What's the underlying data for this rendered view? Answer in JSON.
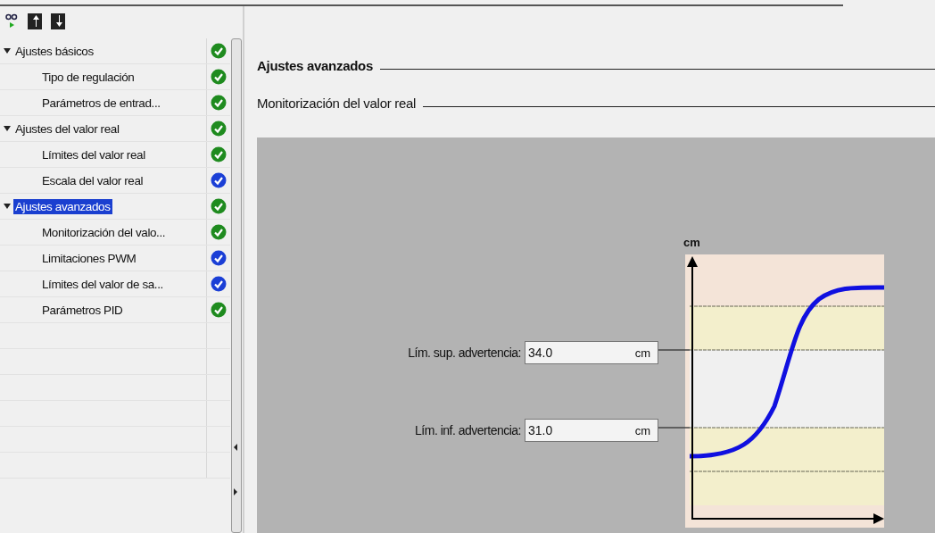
{
  "toolbar": {
    "buttons": [
      {
        "kind": "monitor"
      },
      {
        "kind": "upload"
      },
      {
        "kind": "download"
      }
    ]
  },
  "tree": [
    {
      "label": "Ajustes básicos",
      "expanded": true,
      "selected": false,
      "color": "#1f8b1f",
      "children": [
        {
          "label": "Tipo de regulación",
          "selected": false,
          "color": "#1f8b1f"
        },
        {
          "label": "Parámetros de entrad...",
          "selected": false,
          "color": "#1f8b1f"
        }
      ]
    },
    {
      "label": "Ajustes del valor real",
      "expanded": true,
      "selected": false,
      "color": "#1f8b1f",
      "children": [
        {
          "label": "Límites del valor real",
          "selected": false,
          "color": "#1f8b1f"
        },
        {
          "label": "Escala del valor real",
          "selected": false,
          "color": "#1b3fd6"
        }
      ]
    },
    {
      "label": "Ajustes avanzados",
      "expanded": true,
      "selected": true,
      "color": "#1f8b1f",
      "children": [
        {
          "label": "Monitorización del valo...",
          "selected": false,
          "color": "#1f8b1f"
        },
        {
          "label": "Limitaciones PWM",
          "selected": false,
          "color": "#1b3fd6"
        },
        {
          "label": "Límites del valor de sa...",
          "selected": false,
          "color": "#1b3fd6"
        },
        {
          "label": "Parámetros PID",
          "selected": false,
          "color": "#1f8b1f"
        }
      ]
    }
  ],
  "content": {
    "section_title": "Ajustes avanzados",
    "subsection_title": "Monitorización del valor real",
    "fields": [
      {
        "label": "Lím. sup. advertencia:",
        "value": "34.0",
        "unit": "cm"
      },
      {
        "label": "Lím. inf. advertencia:",
        "value": "31.0",
        "unit": "cm"
      }
    ],
    "diagram": {
      "axis_label": "cm"
    }
  }
}
